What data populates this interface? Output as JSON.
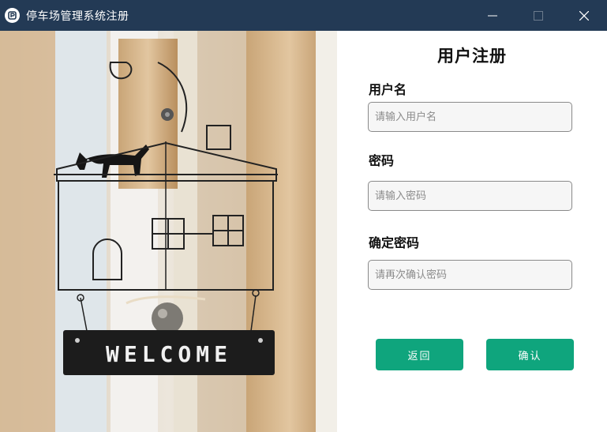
{
  "window": {
    "title": "停车场管理系统注册",
    "controls": [
      "minimize-icon",
      "maximize-icon",
      "close-icon"
    ]
  },
  "image": {
    "sign_text": "WELCOME"
  },
  "form": {
    "title": "用户注册",
    "username": {
      "label": "用户名",
      "placeholder": "请输入用户名",
      "value": ""
    },
    "password": {
      "label": "密码",
      "placeholder": "请输入密码",
      "value": ""
    },
    "confirm_password": {
      "label": "确定密码",
      "placeholder": "请再次确认密码",
      "value": ""
    },
    "buttons": {
      "back": "返回",
      "confirm": "确认"
    }
  },
  "colors": {
    "titlebar": "#233a55",
    "button": "#0fa57d",
    "input_bg": "#f6f6f6"
  }
}
